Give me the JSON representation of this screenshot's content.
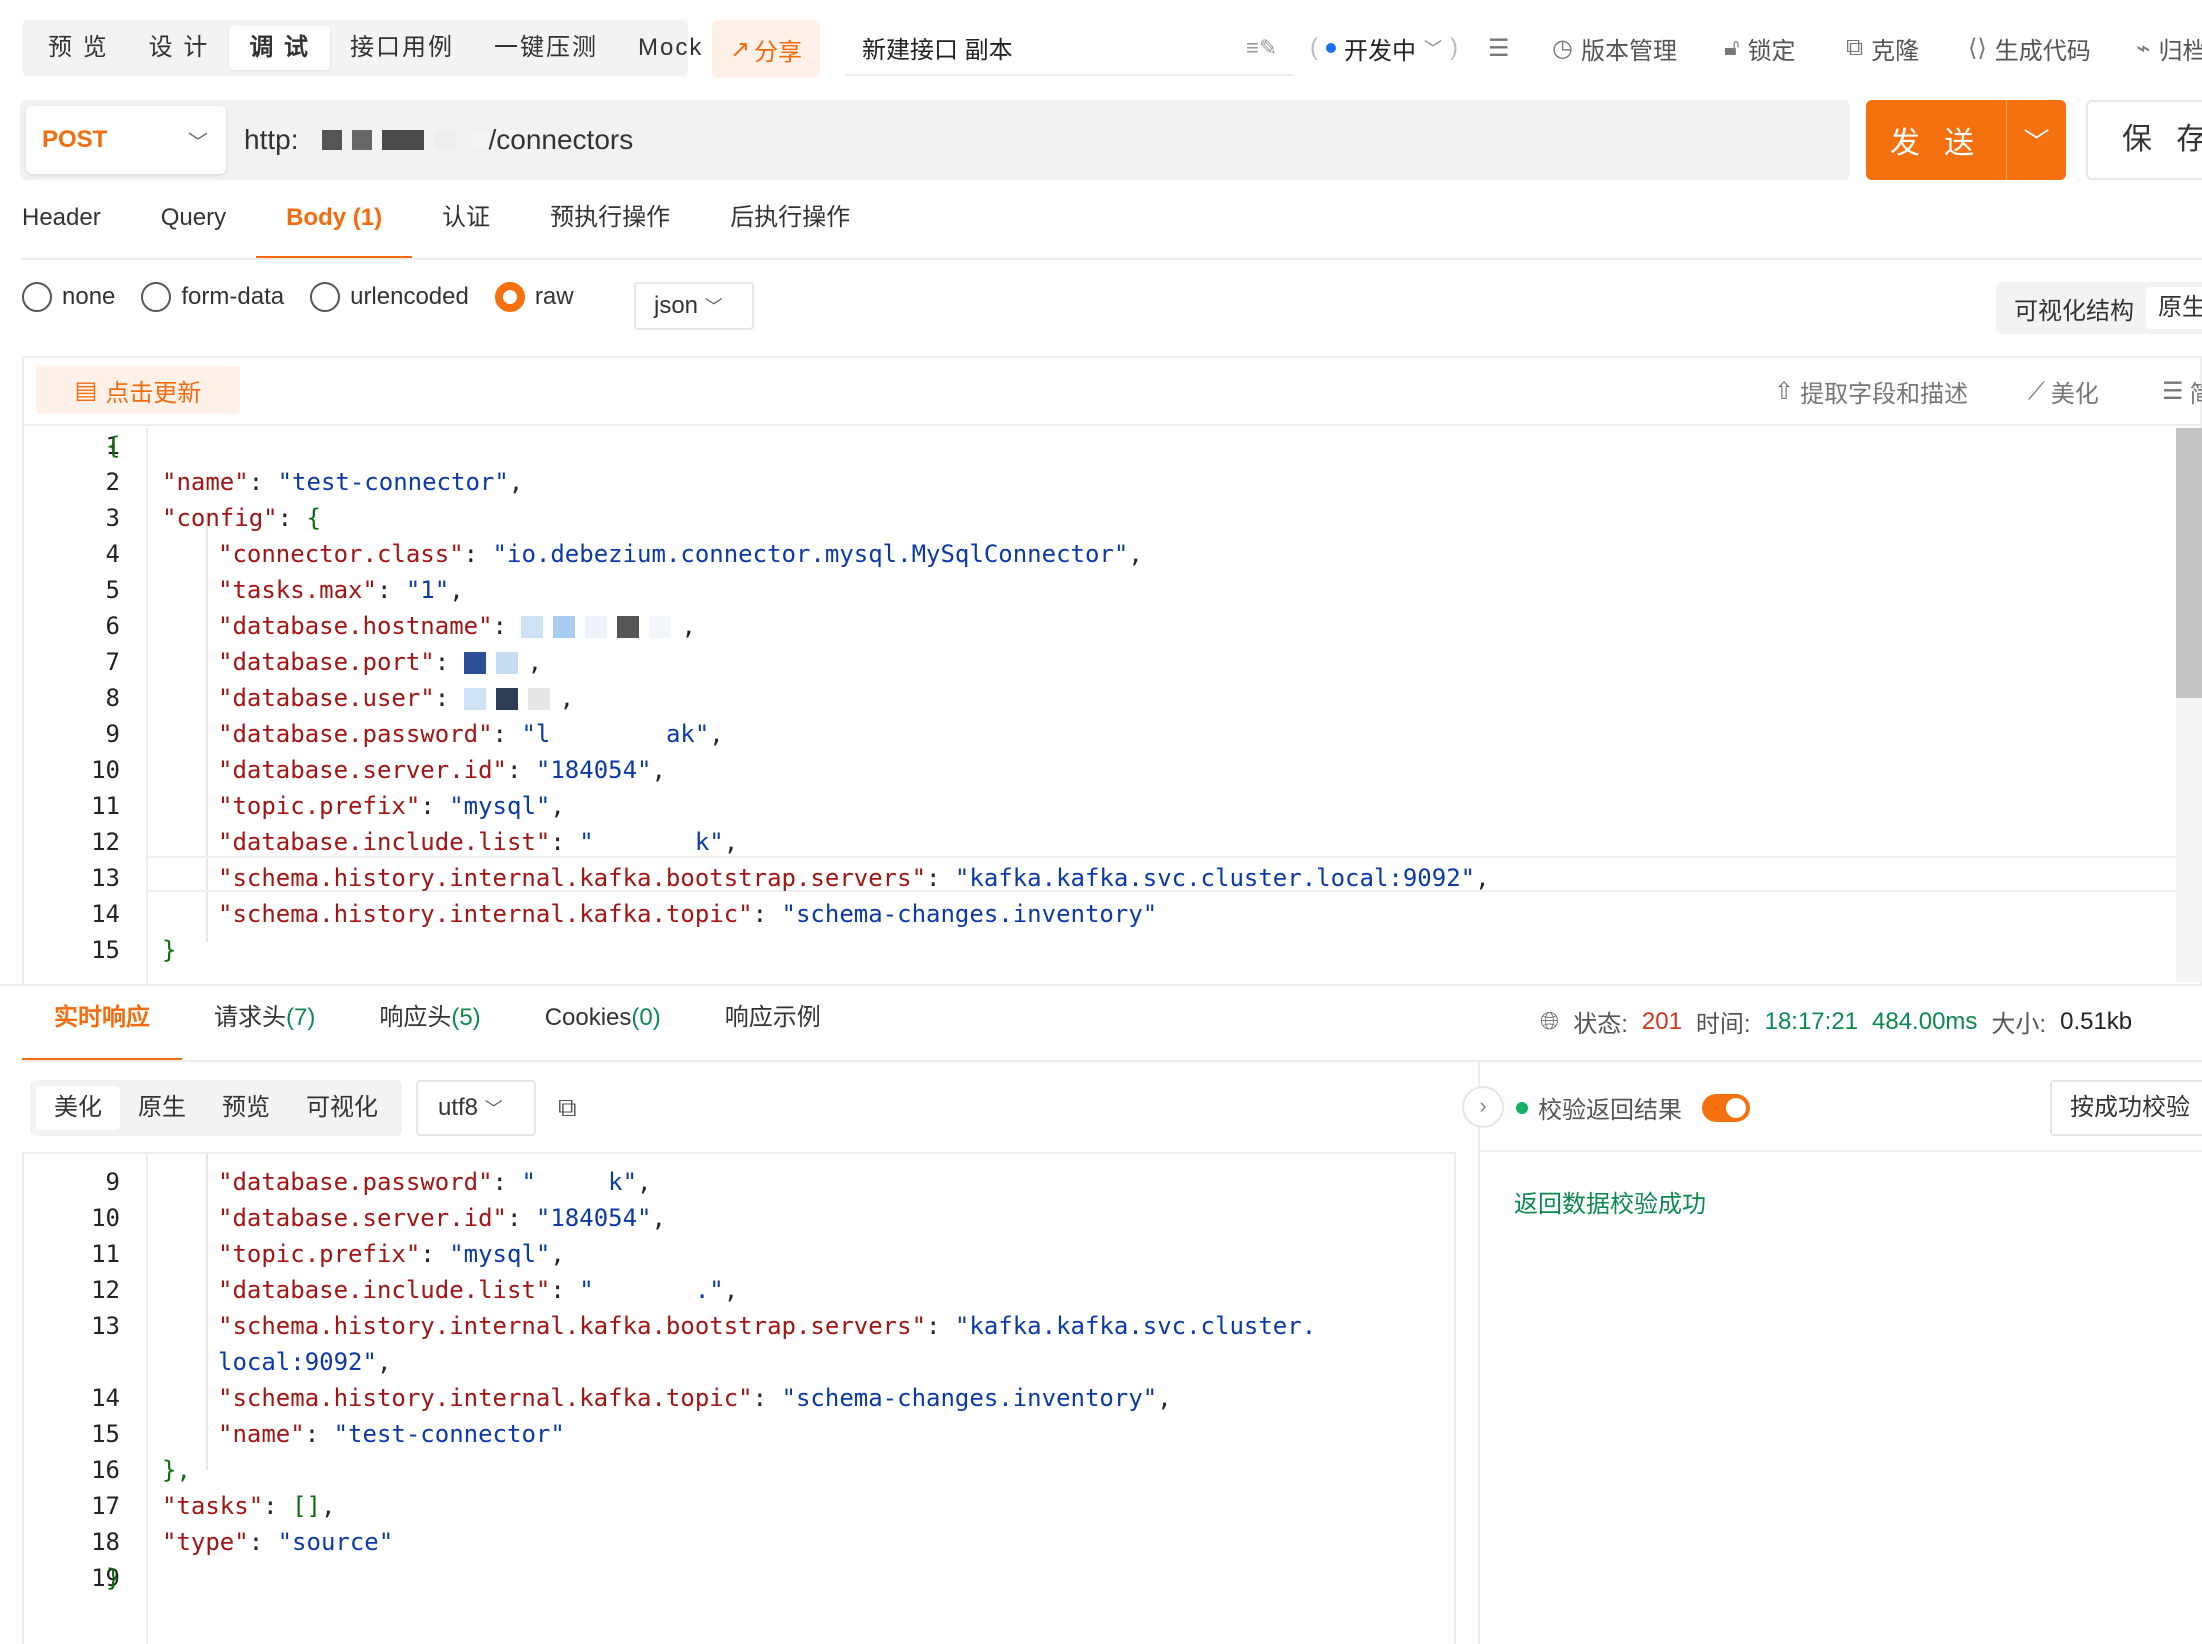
{
  "mode_tabs": [
    "预 览",
    "设 计",
    "调 试",
    "接口用例",
    "一键压测",
    "Mock"
  ],
  "share_label": "分享",
  "api_name": "新建接口 副本",
  "toolbar": {
    "status": "开发中",
    "version": "版本管理",
    "lock": "锁定",
    "clone": "克隆",
    "gen_code": "生成代码",
    "archive": "归档"
  },
  "request": {
    "method": "POST",
    "url_prefix": "http:",
    "url_suffix": "/connectors",
    "send_label": "发 送",
    "save_label": "保 存"
  },
  "req_tabs": [
    "Header",
    "Query",
    "Body (1)",
    "认证",
    "预执行操作",
    "后执行操作"
  ],
  "body_types": [
    "none",
    "form-data",
    "urlencoded",
    "raw"
  ],
  "body_format": "json",
  "view_modes": [
    "可视化结构",
    "原生"
  ],
  "editor": {
    "update_label": "点击更新",
    "extract_label": "提取字段和描述",
    "beautify_label": "美化",
    "simplify_label": "简"
  },
  "request_body": [
    {
      "n": "1",
      "text": "{"
    },
    {
      "n": "2",
      "key": "\"name\"",
      "val": "\"test-connector\"",
      "tail": ","
    },
    {
      "n": "3",
      "key": "\"config\"",
      "val": "{",
      "tail": ""
    },
    {
      "n": "4",
      "key": "\"connector.class\"",
      "val": "\"io.debezium.connector.mysql.MySqlConnector\"",
      "tail": ","
    },
    {
      "n": "5",
      "key": "\"tasks.max\"",
      "val": "\"1\"",
      "tail": ","
    },
    {
      "n": "6",
      "key": "\"database.hostname\"",
      "val": "",
      "tail": ","
    },
    {
      "n": "7",
      "key": "\"database.port\"",
      "val": "",
      "tail": ","
    },
    {
      "n": "8",
      "key": "\"database.user\"",
      "val": "",
      "tail": ","
    },
    {
      "n": "9",
      "key": "\"database.password\"",
      "val": "\"l        ak\"",
      "tail": ","
    },
    {
      "n": "10",
      "key": "\"database.server.id\"",
      "val": "\"184054\"",
      "tail": ","
    },
    {
      "n": "11",
      "key": "\"topic.prefix\"",
      "val": "\"mysql\"",
      "tail": ","
    },
    {
      "n": "12",
      "key": "\"database.include.list\"",
      "val": "\"       k\"",
      "tail": ","
    },
    {
      "n": "13",
      "key": "\"schema.history.internal.kafka.bootstrap.servers\"",
      "val": "\"kafka.kafka.svc.cluster.local:9092\"",
      "tail": ","
    },
    {
      "n": "14",
      "key": "\"schema.history.internal.kafka.topic\"",
      "val": "\"schema-changes.inventory\"",
      "tail": ""
    },
    {
      "n": "15",
      "text": "}"
    }
  ],
  "response_tabs": [
    {
      "label": "实时响应",
      "count": ""
    },
    {
      "label": "请求头",
      "count": "(7)"
    },
    {
      "label": "响应头",
      "count": "(5)"
    },
    {
      "label": "Cookies",
      "count": "(0)"
    },
    {
      "label": "响应示例",
      "count": ""
    }
  ],
  "response_status": {
    "status_label": "状态:",
    "status": "201",
    "time_label": "时间:",
    "time": "18:17:21",
    "duration": "484.00ms",
    "size_label": "大小:",
    "size": "0.51kb"
  },
  "response_views": [
    "美化",
    "原生",
    "预览",
    "可视化"
  ],
  "response_encoding": "utf8",
  "verify": {
    "label": "校验返回结果",
    "mode": "按成功校验",
    "message": "返回数据校验成功"
  },
  "response_body": [
    {
      "n": "9",
      "key": "\"database.password\"",
      "val": "\"     k\"",
      "tail": ","
    },
    {
      "n": "10",
      "key": "\"database.server.id\"",
      "val": "\"184054\"",
      "tail": ","
    },
    {
      "n": "11",
      "key": "\"topic.prefix\"",
      "val": "\"mysql\"",
      "tail": ","
    },
    {
      "n": "12",
      "key": "\"database.include.list\"",
      "val": "\"       .\"",
      "tail": ","
    },
    {
      "n": "13",
      "key": "\"schema.history.internal.kafka.bootstrap.servers\"",
      "val": "\"kafka.kafka.svc.cluster.",
      "tail": ""
    },
    {
      "n": "",
      "key": "",
      "val": "local:9092\"",
      "tail": ","
    },
    {
      "n": "14",
      "key": "\"schema.history.internal.kafka.topic\"",
      "val": "\"schema-changes.inventory\"",
      "tail": ","
    },
    {
      "n": "15",
      "key": "\"name\"",
      "val": "\"test-connector\"",
      "tail": ""
    },
    {
      "n": "16",
      "text": "},"
    },
    {
      "n": "17",
      "key": "\"tasks\"",
      "val": "[]",
      "tail": ","
    },
    {
      "n": "18",
      "key": "\"type\"",
      "val": "\"source\"",
      "tail": ""
    },
    {
      "n": "19",
      "text": "}"
    }
  ]
}
